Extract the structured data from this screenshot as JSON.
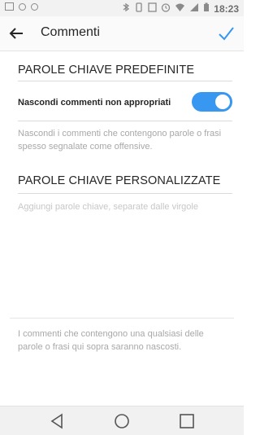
{
  "status_bar": {
    "time": "18:23",
    "left_icons": [
      "image-icon",
      "messenger-icon",
      "telegram-icon"
    ],
    "right_icons": [
      "bluetooth-icon",
      "vibrate-icon",
      "nfc-icon",
      "alarm-icon",
      "wifi-icon",
      "signal-icon",
      "battery-icon"
    ]
  },
  "toolbar": {
    "title": "Commenti"
  },
  "default_keywords": {
    "section_title": "PAROLE CHIAVE PREDEFINITE",
    "toggle_label": "Nascondi commenti non appropriati",
    "toggle_on": true,
    "description": "Nascondi i commenti che contengono parole o frasi spesso segnalate come offensive."
  },
  "custom_keywords": {
    "section_title": "PAROLE CHIAVE PERSONALIZZATE",
    "placeholder": "Aggiungi parole chiave, separate dalle virgole"
  },
  "footer_note": "I commenti che contengono una qualsiasi delle parole o frasi qui sopra saranno nascosti.",
  "colors": {
    "accent": "#3897f0",
    "text_primary": "#262626",
    "text_secondary": "#a8a8a8"
  }
}
